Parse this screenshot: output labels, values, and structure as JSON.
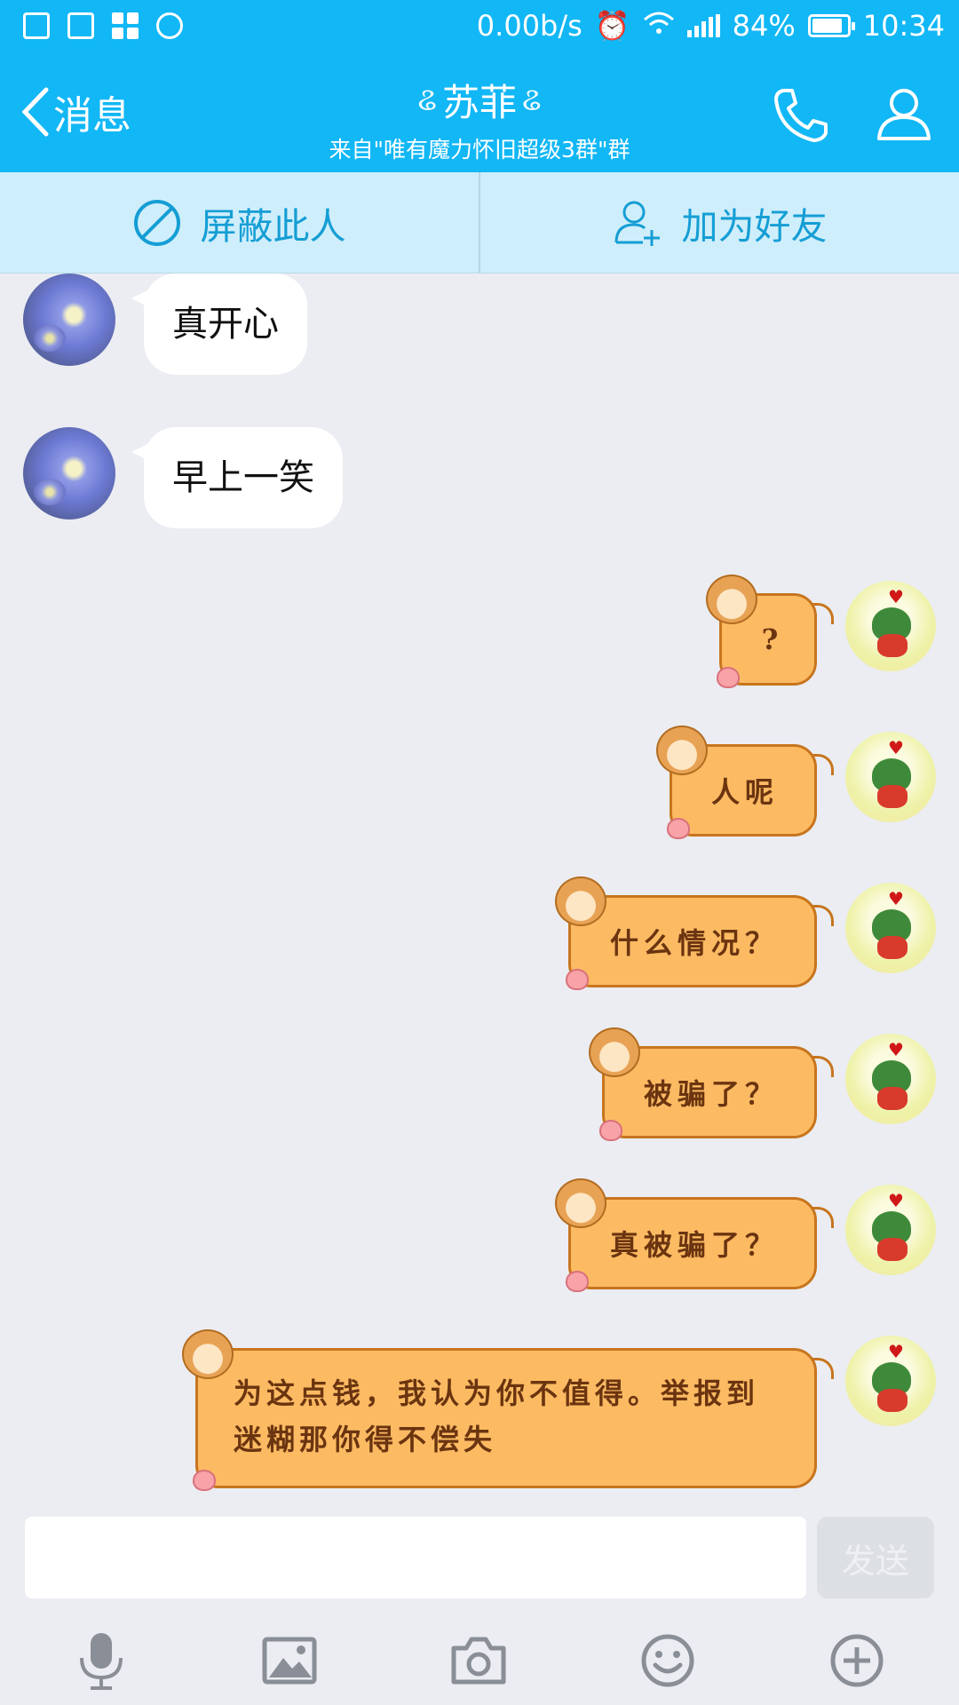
{
  "status_bar": {
    "speed": "0.00b/s",
    "battery": "84%",
    "time": "10:34"
  },
  "header": {
    "back_label": "消息",
    "title": "苏菲",
    "subtitle": "来自\"唯有魔力怀旧超级3群\"群"
  },
  "actions": {
    "block_label": "屏蔽此人",
    "add_friend_label": "加为好友"
  },
  "messages_in": [
    {
      "text": "真开心"
    },
    {
      "text": "早上一笑"
    }
  ],
  "messages_out": [
    {
      "text": "?"
    },
    {
      "text": "人呢"
    },
    {
      "text": "什么情况？"
    },
    {
      "text": "被骗了？"
    },
    {
      "text": "真被骗了？"
    },
    {
      "text": "为这点钱，我认为你不值得。举报到迷糊那你得不偿失"
    }
  ],
  "input": {
    "value": "",
    "send_label": "发送"
  },
  "colors": {
    "brand": "#12b7f5",
    "bubble_out": "#fcbb63",
    "action_text": "#159ed5"
  },
  "icons": [
    "microphone-icon",
    "image-icon",
    "camera-icon",
    "emoji-icon",
    "plus-icon"
  ]
}
